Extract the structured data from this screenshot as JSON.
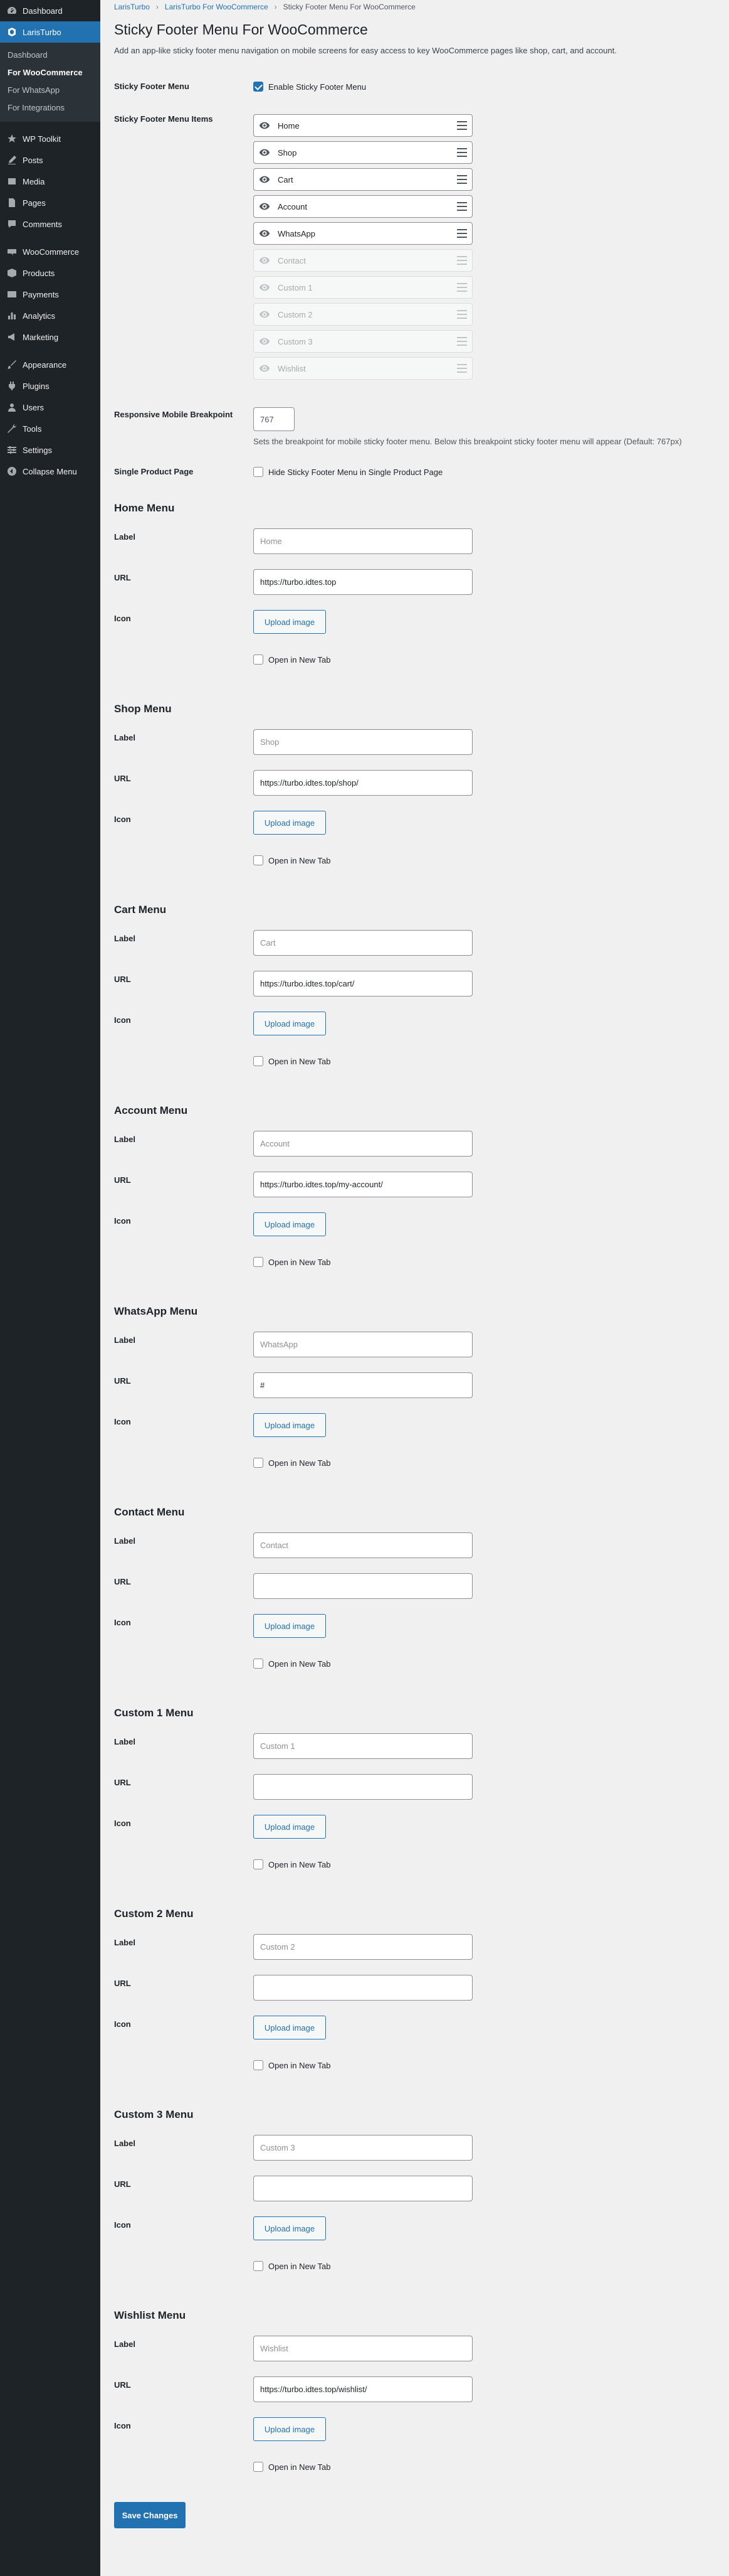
{
  "sidebar": {
    "items": [
      {
        "label": "Dashboard",
        "icon": "dashboard-icon"
      },
      {
        "label": "LarisTurbo",
        "icon": "laristurbo-icon",
        "active": true
      },
      {
        "label": "WP Toolkit",
        "icon": "wp-toolkit-icon"
      },
      {
        "label": "Posts",
        "icon": "posts-icon"
      },
      {
        "label": "Media",
        "icon": "media-icon"
      },
      {
        "label": "Pages",
        "icon": "pages-icon"
      },
      {
        "label": "Comments",
        "icon": "comments-icon"
      },
      {
        "label": "WooCommerce",
        "icon": "woocommerce-icon"
      },
      {
        "label": "Products",
        "icon": "products-icon"
      },
      {
        "label": "Payments",
        "icon": "payments-icon"
      },
      {
        "label": "Analytics",
        "icon": "analytics-icon"
      },
      {
        "label": "Marketing",
        "icon": "marketing-icon"
      },
      {
        "label": "Appearance",
        "icon": "appearance-icon"
      },
      {
        "label": "Plugins",
        "icon": "plugins-icon"
      },
      {
        "label": "Users",
        "icon": "users-icon"
      },
      {
        "label": "Tools",
        "icon": "tools-icon"
      },
      {
        "label": "Settings",
        "icon": "settings-icon"
      },
      {
        "label": "Collapse Menu",
        "icon": "collapse-icon"
      }
    ],
    "submenu": [
      "Dashboard",
      "For WooCommerce",
      "For WhatsApp",
      "For Integrations"
    ]
  },
  "breadcrumb": [
    "LarisTurbo",
    "LarisTurbo For WooCommerce",
    "Sticky Footer Menu For WooCommerce"
  ],
  "page": {
    "title": "Sticky Footer Menu For WooCommerce",
    "description": "Add an app-like sticky footer menu navigation on mobile screens for easy access to key WooCommerce pages like shop, cart, and account."
  },
  "settings": {
    "sticky_label": "Sticky Footer Menu",
    "sticky_checkbox": "Enable Sticky Footer Menu",
    "items_label": "Sticky Footer Menu Items",
    "items": [
      {
        "name": "Home",
        "enabled": true
      },
      {
        "name": "Shop",
        "enabled": true
      },
      {
        "name": "Cart",
        "enabled": true
      },
      {
        "name": "Account",
        "enabled": true
      },
      {
        "name": "WhatsApp",
        "enabled": true
      },
      {
        "name": "Contact",
        "enabled": false
      },
      {
        "name": "Custom 1",
        "enabled": false
      },
      {
        "name": "Custom 2",
        "enabled": false
      },
      {
        "name": "Custom 3",
        "enabled": false
      },
      {
        "name": "Wishlist",
        "enabled": false
      }
    ],
    "breakpoint_label": "Responsive Mobile Breakpoint",
    "breakpoint_value": "767",
    "breakpoint_hint": "Sets the breakpoint for mobile sticky footer menu. Below this breakpoint sticky footer menu will appear (Default: 767px)",
    "single_label": "Single Product Page",
    "single_checkbox": "Hide Sticky Footer Menu in Single Product Page"
  },
  "field_labels": {
    "label": "Label",
    "url": "URL",
    "icon": "Icon",
    "upload": "Upload image",
    "new_tab": "Open in New Tab"
  },
  "menus": [
    {
      "title": "Home Menu",
      "label_placeholder": "Home",
      "url": "https://turbo.idtes.top"
    },
    {
      "title": "Shop Menu",
      "label_placeholder": "Shop",
      "url": "https://turbo.idtes.top/shop/"
    },
    {
      "title": "Cart Menu",
      "label_placeholder": "Cart",
      "url": "https://turbo.idtes.top/cart/"
    },
    {
      "title": "Account Menu",
      "label_placeholder": "Account",
      "url": "https://turbo.idtes.top/my-account/"
    },
    {
      "title": "WhatsApp Menu",
      "label_placeholder": "WhatsApp",
      "url": "#"
    },
    {
      "title": "Contact Menu",
      "label_placeholder": "Contact",
      "url": ""
    },
    {
      "title": "Custom 1 Menu",
      "label_placeholder": "Custom 1",
      "url": ""
    },
    {
      "title": "Custom 2 Menu",
      "label_placeholder": "Custom 2",
      "url": ""
    },
    {
      "title": "Custom 3 Menu",
      "label_placeholder": "Custom 3",
      "url": ""
    },
    {
      "title": "Wishlist Menu",
      "label_placeholder": "Wishlist",
      "url": "https://turbo.idtes.top/wishlist/"
    }
  ],
  "save_label": "Save Changes",
  "colors": {
    "sidebar": "#1d2327",
    "accent": "#2271b1",
    "background": "#f0f0f1"
  }
}
